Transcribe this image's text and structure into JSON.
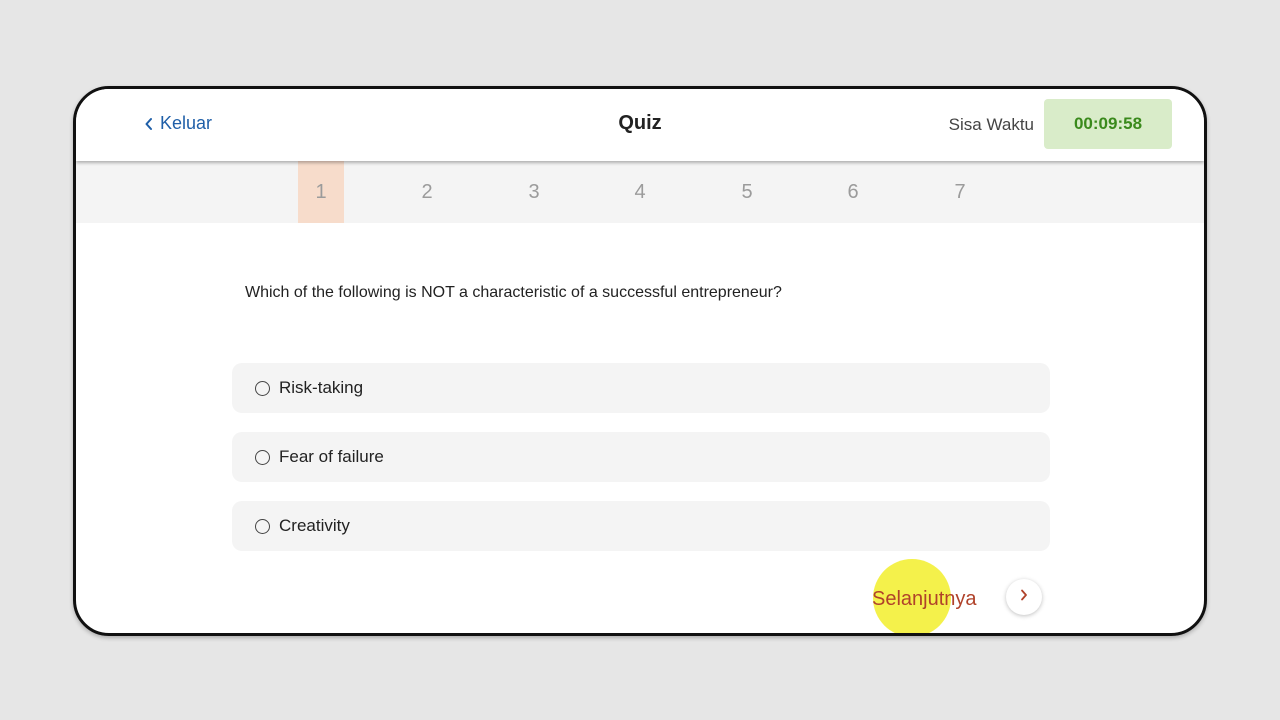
{
  "header": {
    "back_label": "Keluar",
    "title": "Quiz",
    "time_label": "Sisa Waktu",
    "timer": "00:09:58"
  },
  "tabs": [
    "1",
    "2",
    "3",
    "4",
    "5",
    "6",
    "7"
  ],
  "active_tab": "1",
  "question": "Which of the following is NOT a characteristic of a successful entrepreneur?",
  "options": [
    {
      "label": "Risk-taking"
    },
    {
      "label": "Fear of failure"
    },
    {
      "label": "Creativity"
    }
  ],
  "footer": {
    "next_label": "Selanjutnya"
  },
  "icons": {
    "back": "chevron-left-icon",
    "next": "chevron-right-icon",
    "radio": "radio-unchecked-icon"
  },
  "colors": {
    "back_link": "#1f5fa8",
    "timer_bg": "#d9ecc9",
    "timer_text": "#3a8a1c",
    "active_tab_bg": "#f7dccb",
    "next_text": "#b0422a",
    "highlight": "#f2ee2c"
  }
}
